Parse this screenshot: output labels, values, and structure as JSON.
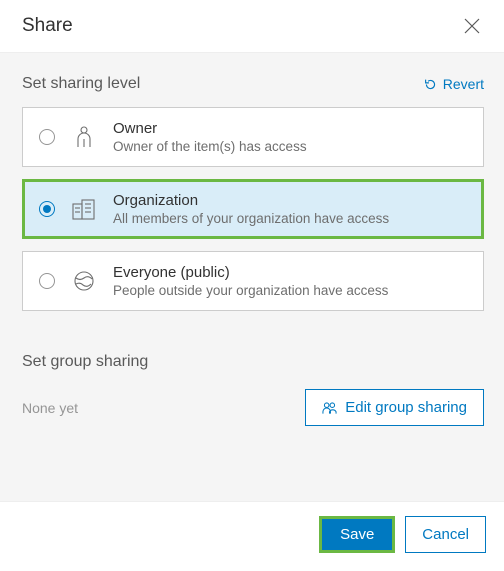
{
  "header": {
    "title": "Share"
  },
  "sharingLevel": {
    "label": "Set sharing level",
    "revert": "Revert",
    "options": [
      {
        "title": "Owner",
        "desc": "Owner of the item(s) has access",
        "selected": false
      },
      {
        "title": "Organization",
        "desc": "All members of your organization have access",
        "selected": true
      },
      {
        "title": "Everyone (public)",
        "desc": "People outside your organization have access",
        "selected": false
      }
    ]
  },
  "groupSharing": {
    "label": "Set group sharing",
    "status": "None yet",
    "editLabel": "Edit group sharing"
  },
  "footer": {
    "save": "Save",
    "cancel": "Cancel"
  }
}
